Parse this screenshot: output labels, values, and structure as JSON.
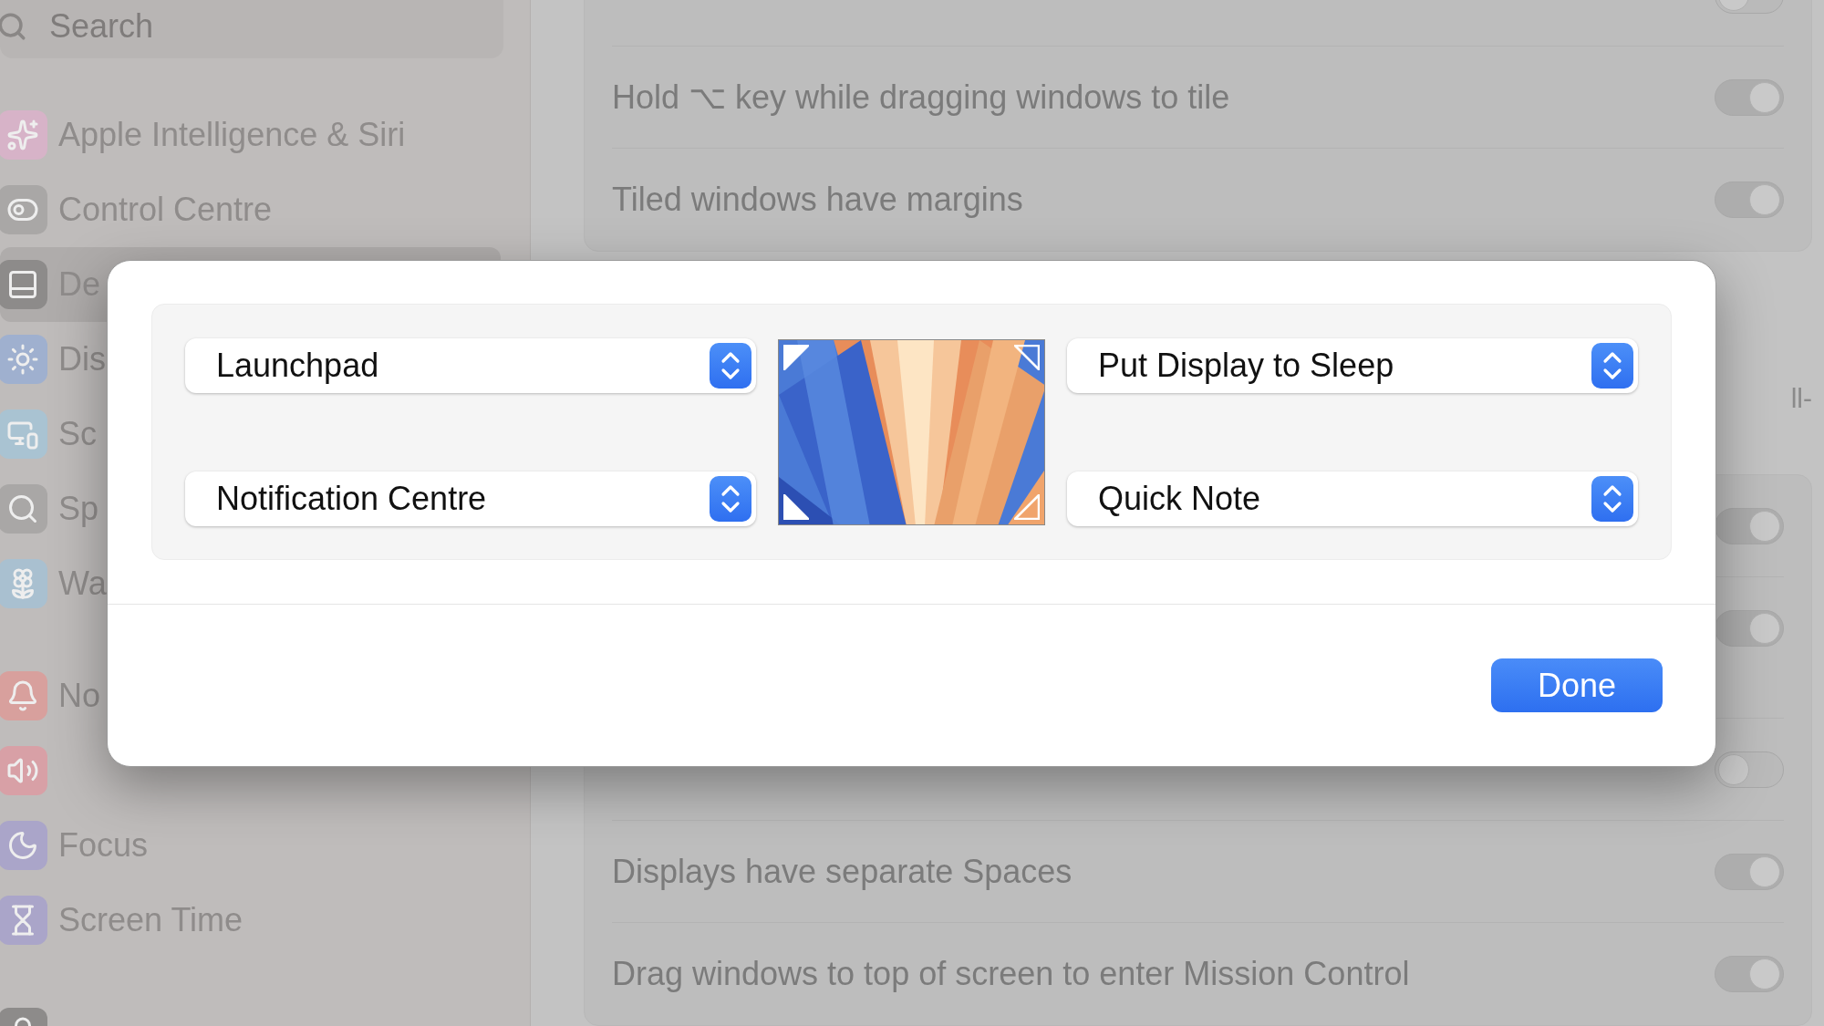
{
  "sidebar": {
    "search": {
      "placeholder": "Search"
    },
    "items": [
      {
        "label": "Apple Intelligence & Siri",
        "color": "#d7b3c8",
        "selected": false
      },
      {
        "label": "Control Centre",
        "color": "#a9a7a6",
        "selected": false
      },
      {
        "label": "De",
        "color": "#8d8b8a",
        "selected": true
      },
      {
        "label": "Dis",
        "color": "#9fb0cf",
        "selected": false
      },
      {
        "label": "Sc",
        "color": "#a9c3d2",
        "selected": false
      },
      {
        "label": "Sp",
        "color": "#a9a7a6",
        "selected": false
      },
      {
        "label": "Wa",
        "color": "#a9c0d0",
        "selected": false
      },
      {
        "label": "No",
        "color": "#d8a09d",
        "selected": false
      },
      {
        "color": "#d8a0a6",
        "selected": false
      },
      {
        "label": "Focus",
        "color": "#aaa5c9",
        "selected": false
      },
      {
        "label": "Screen Time",
        "color": "#aaa5c9",
        "selected": false
      },
      {
        "color": "#8d8b8a",
        "selected": false
      }
    ]
  },
  "settings": [
    {
      "rows": [
        {
          "on": false
        },
        {
          "label": "Hold ⌥ key while dragging windows to tile",
          "on": true
        },
        {
          "label": "Tiled windows have margins",
          "on": true
        }
      ]
    },
    {
      "note": "ll-"
    },
    {
      "rows": [
        {
          "on": true
        },
        {
          "on": true
        },
        {
          "on": false
        },
        {
          "label": "Displays have separate Spaces",
          "on": true
        },
        {
          "label": "Drag windows to top of screen to enter Mission Control",
          "on": true
        }
      ]
    }
  ],
  "hot_corners": {
    "top_left": "Launchpad",
    "bottom_left": "Notification Centre",
    "top_right": "Put Display to Sleep",
    "bottom_right": "Quick Note",
    "done": "Done"
  }
}
